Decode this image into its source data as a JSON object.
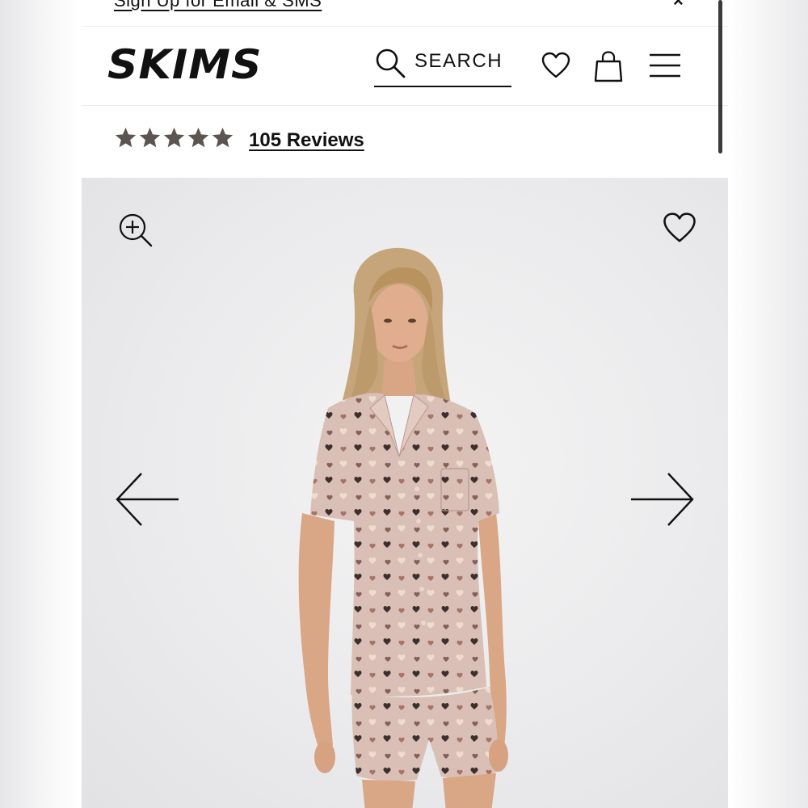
{
  "promo": {
    "link_text": "Sign Up for Email & SMS",
    "close_icon": "close-icon"
  },
  "header": {
    "logo": "SKIMS",
    "search_label": "SEARCH",
    "icons": [
      "search-icon",
      "heart-icon",
      "shopping-bag-icon",
      "hamburger-menu-icon"
    ]
  },
  "reviews": {
    "rating": 5,
    "max_rating": 5,
    "link_text": "105 Reviews",
    "star_color": "#5b5450"
  },
  "gallery": {
    "icons": [
      "zoom-in-icon",
      "heart-outline-icon",
      "arrow-left-icon",
      "arrow-right-icon"
    ],
    "background": "#ebebed",
    "pajama_color": "#d9bfb5"
  }
}
